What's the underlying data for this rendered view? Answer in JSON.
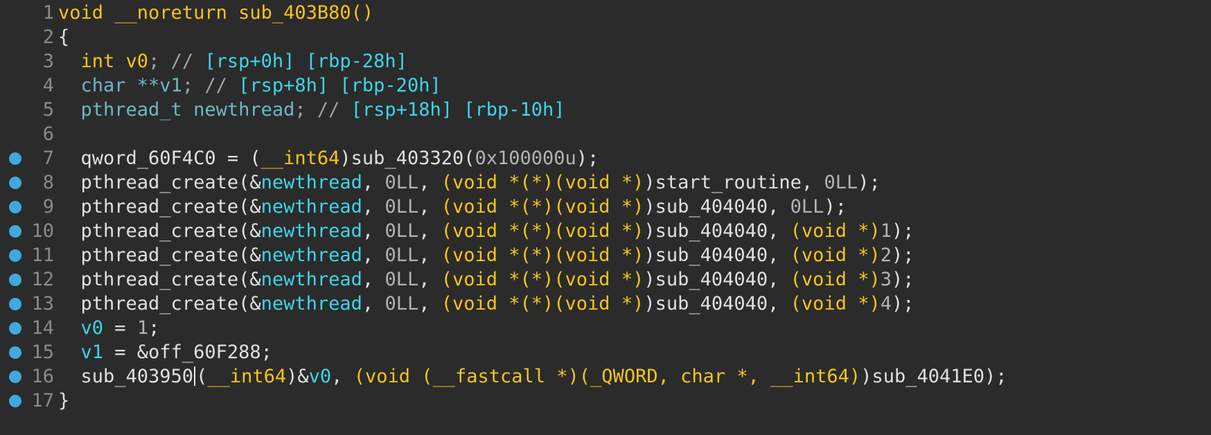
{
  "colors": {
    "background": "#2b2b2b",
    "default": "#e0e0e0",
    "keyword": "#f5c518",
    "local": "#3ed5e8",
    "comment": "#9fa4a8",
    "comment_reg": "#3ed5e8",
    "number": "#b3b3b3",
    "typename": "#6bb8c4",
    "line_number": "#8a8a8a",
    "breakpoint": "#40a8e0"
  },
  "lines": [
    {
      "n": "1",
      "bp": false,
      "tokens": [
        {
          "t": "void __noreturn sub_403B80",
          "k": "keyword"
        },
        {
          "t": "()",
          "k": "keyword"
        }
      ]
    },
    {
      "n": "2",
      "bp": false,
      "tokens": [
        {
          "t": "{",
          "k": "default"
        }
      ]
    },
    {
      "n": "3",
      "bp": false,
      "tokens": [
        {
          "t": "  ",
          "k": "default"
        },
        {
          "t": "int ",
          "k": "keyword"
        },
        {
          "t": "v0",
          "k": "keyword"
        },
        {
          "t": "; // ",
          "k": "comment"
        },
        {
          "t": "[rsp+0h] [rbp-28h]",
          "k": "comment_reg"
        }
      ]
    },
    {
      "n": "4",
      "bp": false,
      "tokens": [
        {
          "t": "  ",
          "k": "default"
        },
        {
          "t": "char **v1",
          "k": "typename"
        },
        {
          "t": "; // ",
          "k": "comment"
        },
        {
          "t": "[rsp+8h] [rbp-20h]",
          "k": "comment_reg"
        }
      ]
    },
    {
      "n": "5",
      "bp": false,
      "tokens": [
        {
          "t": "  ",
          "k": "default"
        },
        {
          "t": "pthread_t newthread",
          "k": "typename"
        },
        {
          "t": "; // ",
          "k": "comment"
        },
        {
          "t": "[rsp+18h] [rbp-10h]",
          "k": "comment_reg"
        }
      ]
    },
    {
      "n": "6",
      "bp": false,
      "tokens": []
    },
    {
      "n": "7",
      "bp": true,
      "tokens": [
        {
          "t": "  qword_60F4C0 = ",
          "k": "default"
        },
        {
          "t": "(",
          "k": "default"
        },
        {
          "t": "__int64",
          "k": "keyword"
        },
        {
          "t": ")sub_403320(",
          "k": "default"
        },
        {
          "t": "0x100000u",
          "k": "number"
        },
        {
          "t": ");",
          "k": "default"
        }
      ]
    },
    {
      "n": "8",
      "bp": true,
      "tokens": [
        {
          "t": "  pthread_create(&",
          "k": "default"
        },
        {
          "t": "newthread",
          "k": "local"
        },
        {
          "t": ", ",
          "k": "default"
        },
        {
          "t": "0LL",
          "k": "number"
        },
        {
          "t": ", ",
          "k": "default"
        },
        {
          "t": "(void *(*)(void *)",
          "k": "keyword"
        },
        {
          "t": ")start_routine, ",
          "k": "default"
        },
        {
          "t": "0LL",
          "k": "number"
        },
        {
          "t": ");",
          "k": "default"
        }
      ]
    },
    {
      "n": "9",
      "bp": true,
      "tokens": [
        {
          "t": "  pthread_create(&",
          "k": "default"
        },
        {
          "t": "newthread",
          "k": "local"
        },
        {
          "t": ", ",
          "k": "default"
        },
        {
          "t": "0LL",
          "k": "number"
        },
        {
          "t": ", ",
          "k": "default"
        },
        {
          "t": "(void *(*)(void *)",
          "k": "keyword"
        },
        {
          "t": ")sub_404040, ",
          "k": "default"
        },
        {
          "t": "0LL",
          "k": "number"
        },
        {
          "t": ");",
          "k": "default"
        }
      ]
    },
    {
      "n": "10",
      "bp": true,
      "tokens": [
        {
          "t": "  pthread_create(&",
          "k": "default"
        },
        {
          "t": "newthread",
          "k": "local"
        },
        {
          "t": ", ",
          "k": "default"
        },
        {
          "t": "0LL",
          "k": "number"
        },
        {
          "t": ", ",
          "k": "default"
        },
        {
          "t": "(void *(*)(void *)",
          "k": "keyword"
        },
        {
          "t": ")sub_404040, ",
          "k": "default"
        },
        {
          "t": "(void *)",
          "k": "keyword"
        },
        {
          "t": "1",
          "k": "number"
        },
        {
          "t": ");",
          "k": "default"
        }
      ]
    },
    {
      "n": "11",
      "bp": true,
      "tokens": [
        {
          "t": "  pthread_create(&",
          "k": "default"
        },
        {
          "t": "newthread",
          "k": "local"
        },
        {
          "t": ", ",
          "k": "default"
        },
        {
          "t": "0LL",
          "k": "number"
        },
        {
          "t": ", ",
          "k": "default"
        },
        {
          "t": "(void *(*)(void *)",
          "k": "keyword"
        },
        {
          "t": ")sub_404040, ",
          "k": "default"
        },
        {
          "t": "(void *)",
          "k": "keyword"
        },
        {
          "t": "2",
          "k": "number"
        },
        {
          "t": ");",
          "k": "default"
        }
      ]
    },
    {
      "n": "12",
      "bp": true,
      "tokens": [
        {
          "t": "  pthread_create(&",
          "k": "default"
        },
        {
          "t": "newthread",
          "k": "local"
        },
        {
          "t": ", ",
          "k": "default"
        },
        {
          "t": "0LL",
          "k": "number"
        },
        {
          "t": ", ",
          "k": "default"
        },
        {
          "t": "(void *(*)(void *)",
          "k": "keyword"
        },
        {
          "t": ")sub_404040, ",
          "k": "default"
        },
        {
          "t": "(void *)",
          "k": "keyword"
        },
        {
          "t": "3",
          "k": "number"
        },
        {
          "t": ");",
          "k": "default"
        }
      ]
    },
    {
      "n": "13",
      "bp": true,
      "tokens": [
        {
          "t": "  pthread_create(&",
          "k": "default"
        },
        {
          "t": "newthread",
          "k": "local"
        },
        {
          "t": ", ",
          "k": "default"
        },
        {
          "t": "0LL",
          "k": "number"
        },
        {
          "t": ", ",
          "k": "default"
        },
        {
          "t": "(void *(*)(void *)",
          "k": "keyword"
        },
        {
          "t": ")sub_404040, ",
          "k": "default"
        },
        {
          "t": "(void *)",
          "k": "keyword"
        },
        {
          "t": "4",
          "k": "number"
        },
        {
          "t": ");",
          "k": "default"
        }
      ]
    },
    {
      "n": "14",
      "bp": true,
      "tokens": [
        {
          "t": "  ",
          "k": "default"
        },
        {
          "t": "v0",
          "k": "local"
        },
        {
          "t": " = ",
          "k": "default"
        },
        {
          "t": "1",
          "k": "number"
        },
        {
          "t": ";",
          "k": "default"
        }
      ]
    },
    {
      "n": "15",
      "bp": true,
      "tokens": [
        {
          "t": "  ",
          "k": "default"
        },
        {
          "t": "v1",
          "k": "local"
        },
        {
          "t": " = &off_60F288;",
          "k": "default"
        }
      ]
    },
    {
      "n": "16",
      "bp": true,
      "caret_after": 0,
      "tokens": [
        {
          "t": "  sub_403950",
          "k": "default"
        },
        {
          "t": "(",
          "k": "default"
        },
        {
          "t": "__int64",
          "k": "keyword"
        },
        {
          "t": ")&",
          "k": "default"
        },
        {
          "t": "v0",
          "k": "local"
        },
        {
          "t": ", ",
          "k": "default"
        },
        {
          "t": "(void (__fastcall *)(_QWORD, char *, __int64)",
          "k": "keyword"
        },
        {
          "t": ")sub_4041E0);",
          "k": "default"
        }
      ]
    },
    {
      "n": "17",
      "bp": true,
      "tokens": [
        {
          "t": "}",
          "k": "default"
        }
      ]
    }
  ]
}
